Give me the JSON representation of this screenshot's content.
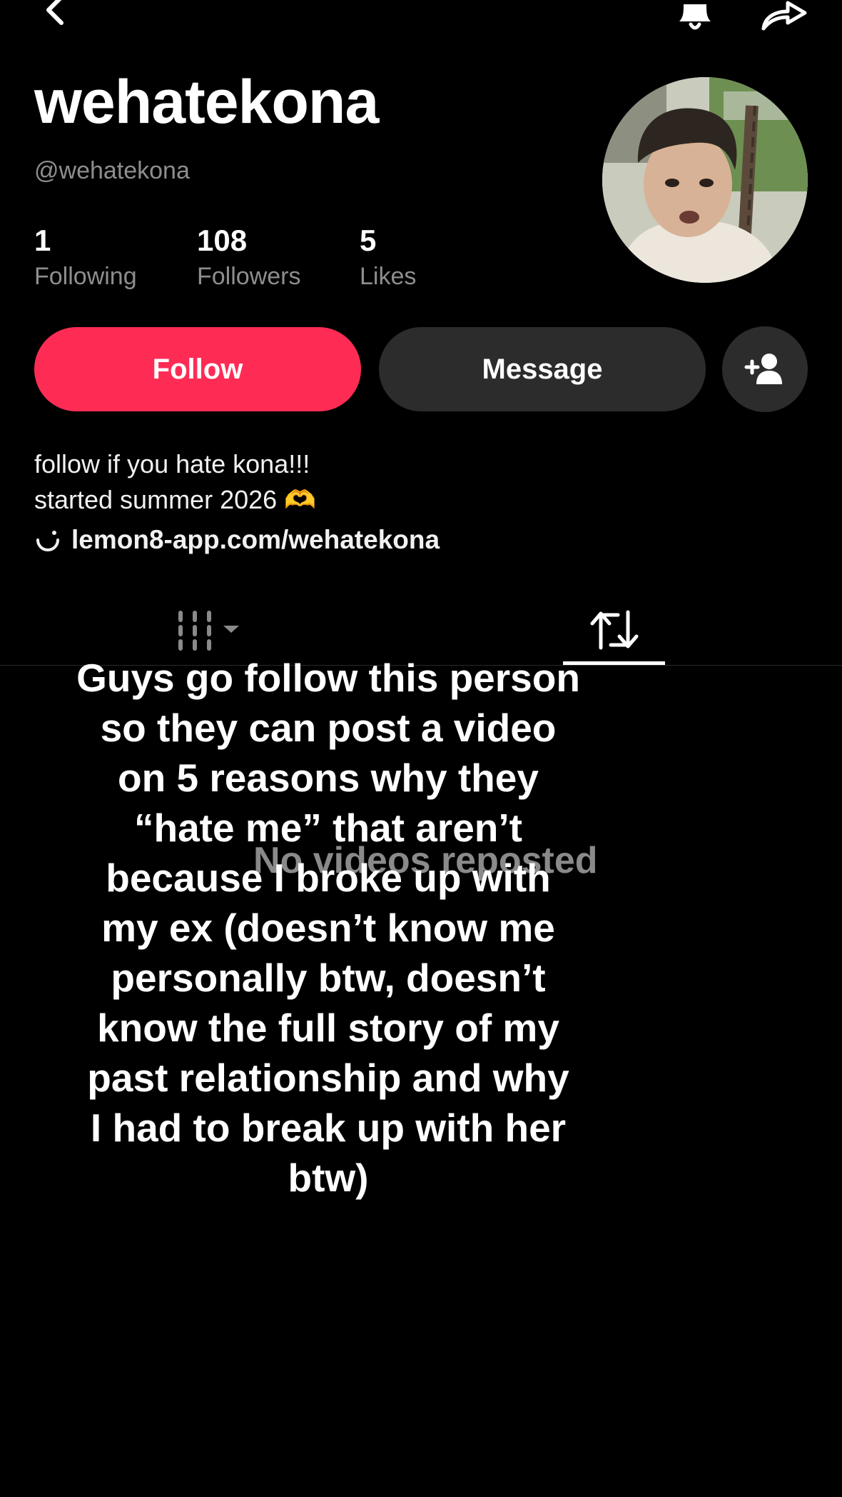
{
  "profile": {
    "display_name": "wehatekona",
    "username": "@wehatekona"
  },
  "stats": {
    "following": {
      "value": "1",
      "label": "Following"
    },
    "followers": {
      "value": "108",
      "label": "Followers"
    },
    "likes": {
      "value": "5",
      "label": "Likes"
    }
  },
  "actions": {
    "follow_label": "Follow",
    "message_label": "Message"
  },
  "bio": {
    "line1": "follow if you hate kona!!!",
    "line2": "started summer 2026 🫶",
    "link": "lemon8-app.com/wehatekona"
  },
  "tabs": {
    "active": "reposts",
    "empty_message": "No videos reposted"
  },
  "overlay_caption": "Guys go follow this person\nso they can post a video\non 5 reasons why they\n“hate me” that aren’t\nbecause I broke up with\nmy ex (doesn’t know me\npersonally btw, doesn’t\nknow the full story of my\npast relationship and why\nI had to break up with her\nbtw)",
  "colors": {
    "background": "#000000",
    "follow_button": "#fe2c55",
    "secondary_button": "#2c2c2c",
    "muted_text": "#8e8e8e"
  },
  "icons": [
    "back-icon",
    "bell-icon",
    "share-icon",
    "add-user-icon",
    "link-icon",
    "grid-icon",
    "repost-icon"
  ]
}
